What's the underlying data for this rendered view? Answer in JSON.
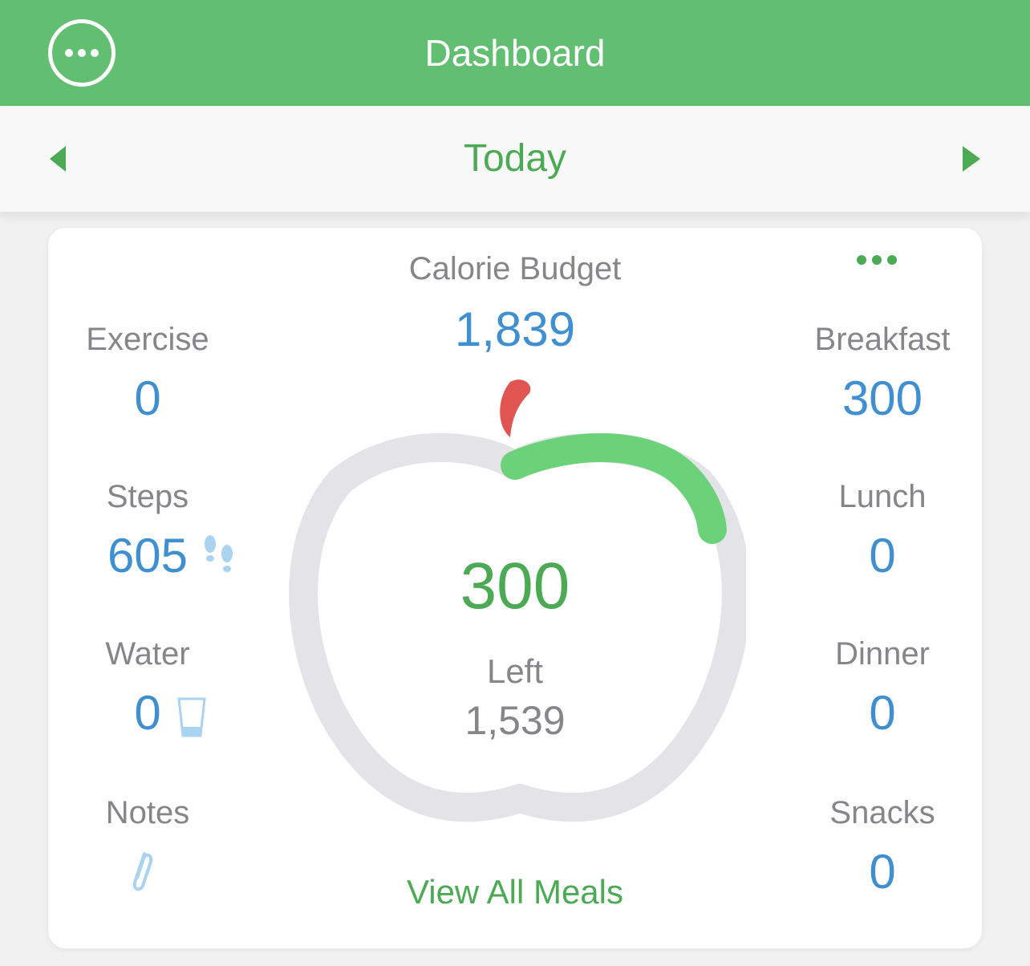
{
  "header": {
    "title": "Dashboard",
    "menu_icon": "more-circle-icon",
    "bg_color": "#62be71"
  },
  "date_nav": {
    "label": "Today",
    "prev_icon": "chevron-left-icon",
    "next_icon": "chevron-right-icon"
  },
  "budget": {
    "label": "Calorie Budget",
    "value": "1,839",
    "options_icon": "more-dots-icon"
  },
  "left_stats": {
    "exercise": {
      "label": "Exercise",
      "value": "0"
    },
    "steps": {
      "label": "Steps",
      "value": "605",
      "icon": "footsteps-icon"
    },
    "water": {
      "label": "Water",
      "value": "0",
      "icon": "water-glass-icon"
    },
    "notes": {
      "label": "Notes",
      "icon": "paperclip-icon"
    }
  },
  "meals": {
    "breakfast": {
      "label": "Breakfast",
      "value": "300"
    },
    "lunch": {
      "label": "Lunch",
      "value": "0"
    },
    "dinner": {
      "label": "Dinner",
      "value": "0"
    },
    "snacks": {
      "label": "Snacks",
      "value": "0"
    }
  },
  "apple_gauge": {
    "eaten": "300",
    "left_label": "Left",
    "left_value": "1,539",
    "progress_fraction": 0.163,
    "track_color": "#e3e3e8",
    "progress_color": "#6bd27a",
    "leaf_color": "#e05550"
  },
  "view_all_meals": "View All Meals",
  "colors": {
    "accent_green": "#4caa55",
    "value_blue": "#3f8fd1",
    "label_gray": "#85858a"
  }
}
